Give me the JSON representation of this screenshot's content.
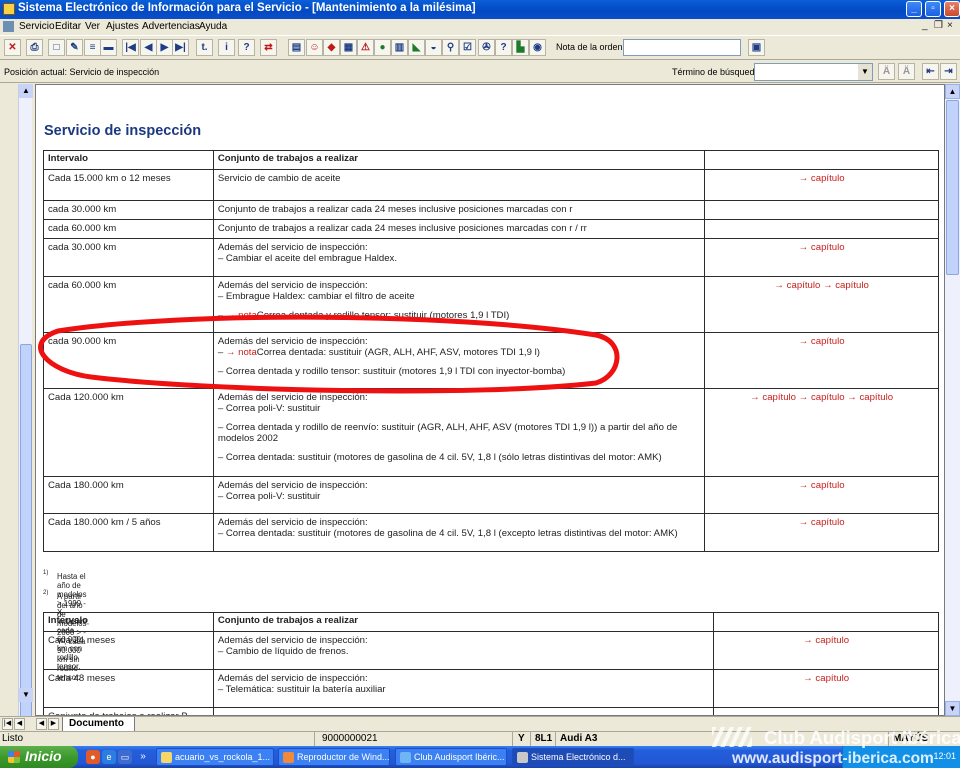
{
  "window": {
    "title": "Sistema Electrónico de Información para el Servicio - [Mantenimiento a la milésima]"
  },
  "menu": {
    "items": [
      "Servicio",
      "Editar",
      "Ver",
      "Ajustes",
      "Advertencias",
      "Ayuda"
    ]
  },
  "toolbar": {
    "order_label": "Nota de la orden:",
    "order_value": ""
  },
  "searchbar": {
    "position": "Posición actual: Servicio de inspección",
    "term_label": "Término de búsqueda:",
    "term_value": ""
  },
  "document": {
    "title": "Servicio de inspección",
    "table1": {
      "headers": [
        "Intervalo",
        "Conjunto de trabajos a realizar",
        ""
      ],
      "rows": [
        {
          "interval": "Cada 15.000 km o 12 meses",
          "intro": "Servicio de cambio de aceite",
          "items": [],
          "link": "→ capítulo"
        },
        {
          "interval": "cada 30.000 km",
          "intro": "Conjunto de trabajos a realizar cada 24 meses inclusive posiciones marcadas con r",
          "items": [],
          "link": ""
        },
        {
          "interval": "cada 60.000 km",
          "intro": "Conjunto de trabajos a realizar cada 24 meses inclusive posiciones marcadas con r / rr",
          "items": [],
          "link": ""
        },
        {
          "interval": "cada 30.000 km",
          "intro": "Además del servicio de inspección:",
          "items": [
            "–  Cambiar el aceite del embrague Haldex."
          ],
          "link": "→ capítulo"
        },
        {
          "interval": "cada 60.000 km",
          "intro": "Además del servicio de inspección:",
          "items": [
            "–  Embrague Haldex: cambiar el filtro de aceite",
            "–  → notaCorrea dentada y rodillo tensor: sustituir (motores 1,9 l TDI)"
          ],
          "link": "→ capítulo → capítulo"
        },
        {
          "interval": "cada 90.000 km",
          "intro": "Además del servicio de inspección:",
          "items": [
            "–  → notaCorrea dentada: sustituir (AGR, ALH, AHF, ASV, motores TDI 1,9 l)",
            "–  Correa dentada y rodillo tensor: sustituir (motores 1,9 l TDI con inyector-bomba)"
          ],
          "link": "→ capítulo"
        },
        {
          "interval": "Cada 120.000 km",
          "intro": "Además del servicio de inspección:",
          "items": [
            "–  Correa poli-V: sustituir",
            "–  Correa dentada y rodillo de reenvío: sustituir (AGR, ALH, AHF, ASV (motores TDI 1,9 l)) a partir del año de modelos 2002",
            "–  Correa dentada: sustituir (motores de gasolina de 4 cil. 5V, 1,8 l (sólo letras distintivas del motor: AMK)"
          ],
          "link": "→ capítulo → capítulo → capítulo"
        },
        {
          "interval": "Cada 180.000 km",
          "intro": "Además del servicio de inspección:",
          "items": [
            "–  Correa poli-V: sustituir"
          ],
          "link": "→ capítulo"
        },
        {
          "interval": "Cada 180.000 km / 5 años",
          "intro": "Además del servicio de inspección:",
          "items": [
            "–  Correa dentada: sustituir (motores de gasolina de 4 cil. 5V, 1,8 l (excepto letras distintivas del motor: AMK)"
          ],
          "link": "→ capítulo"
        }
      ]
    },
    "footnotes": [
      {
        "mark": "1)",
        "text": "Hasta el año de modelos > 1999 -X- inclusive, cada 60.000 km con rodillo tensor."
      },
      {
        "mark": "2)",
        "text": "A partir del año de modelos 2000 > -Y-, cada 90.000 km sin rodillo tensor."
      }
    ],
    "table2": {
      "headers": [
        "Intervalo",
        "Conjunto de trabajos a realizar",
        ""
      ],
      "rows": [
        {
          "interval": "Cada 24 meses",
          "intro": "Además del servicio de inspección:",
          "items": [
            "–  Cambio de líquido de frenos."
          ],
          "link": "→ capítulo"
        },
        {
          "interval": "Cada 48 meses",
          "intro": "Además del servicio de inspección:",
          "items": [
            "–  Telemática: sustituir la batería auxiliar"
          ],
          "link": "→ capítulo"
        },
        {
          "interval": "Conjunto de trabajos a realizar B",
          "intro": "",
          "items": [],
          "link": ""
        }
      ]
    }
  },
  "doc_tab": "Documento",
  "status": {
    "ready": "Listo",
    "order_number": "9000000021",
    "model_code1": "Y",
    "model_code2": "8L1",
    "model_name": "Audi A3",
    "mode": "MAYÚS"
  },
  "taskbar": {
    "start": "Inicio",
    "tasks": [
      "acuario_vs_rockola_1...",
      "Reproductor de Wind...",
      "Club Audisport Ibéric...",
      "Sistema Electrónico d..."
    ],
    "clock": "12:01"
  },
  "watermark": {
    "line1": "Club Audisport Ibérica",
    "line2": "www.audisport-iberica.com"
  }
}
